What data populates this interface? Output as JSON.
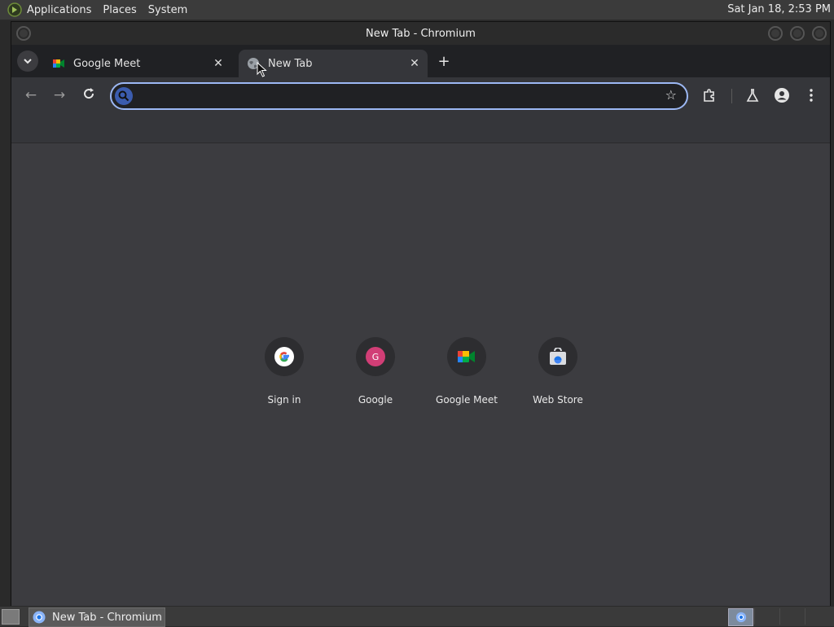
{
  "top_panel": {
    "menus": [
      "Applications",
      "Places",
      "System"
    ],
    "clock": "Sat Jan 18,  2:53 PM"
  },
  "window": {
    "title": "New Tab - Chromium"
  },
  "tabs": [
    {
      "label": "Google Meet",
      "active": false
    },
    {
      "label": "New Tab",
      "active": true
    }
  ],
  "toolbar": {
    "omnibox_value": ""
  },
  "shortcuts": [
    {
      "title": "Sign in",
      "icon": "google-g-icon"
    },
    {
      "title": "Google",
      "icon": "letter-avatar-icon",
      "letter": "G",
      "color": "#d13e76"
    },
    {
      "title": "Google Meet",
      "icon": "google-meet-icon"
    },
    {
      "title": "Web Store",
      "icon": "web-store-icon"
    }
  ],
  "taskbar": {
    "window_item": "New Tab - Chromium"
  },
  "colors": {
    "omnibox_border": "#9cb8f4",
    "content_bg": "#3c3c40"
  }
}
